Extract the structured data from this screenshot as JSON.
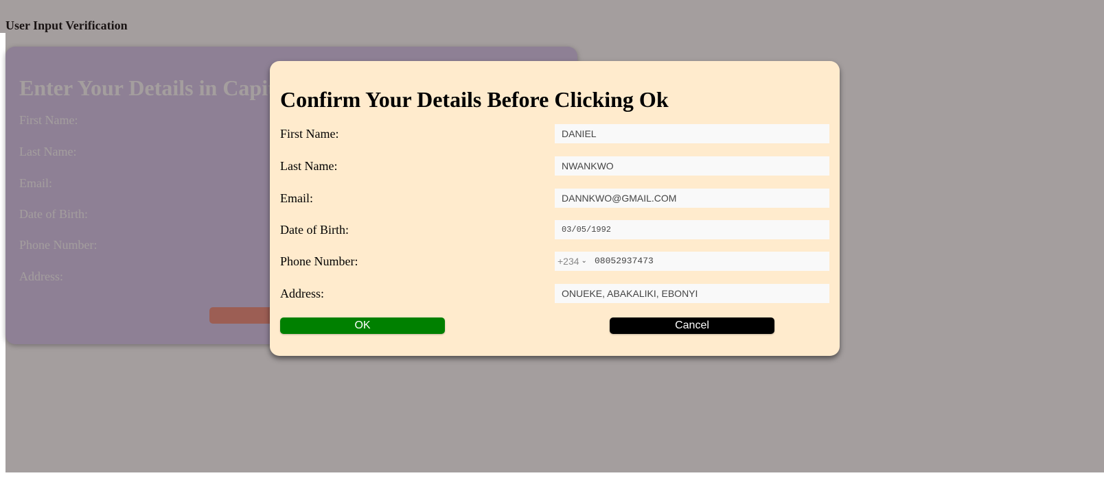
{
  "page": {
    "heading": "User Input Verification"
  },
  "form": {
    "title": "Enter Your Details in Capital Letters",
    "labels": [
      "First Name:",
      "Last Name:",
      "Email:",
      "Date of Birth:",
      "Phone Number:",
      "Address:"
    ]
  },
  "modal": {
    "title": "Confirm Your Details Before Clicking Ok",
    "fields": [
      {
        "label": "First Name:",
        "value": "DANIEL"
      },
      {
        "label": "Last Name:",
        "value": "NWANKWO"
      },
      {
        "label": "Email:",
        "value": "DANNKWO@GMAIL.COM"
      },
      {
        "label": "Date of Birth:",
        "value": "03/05/1992"
      },
      {
        "label": "Phone Number:",
        "value": "08052937473",
        "country_code": "+234"
      },
      {
        "label": "Address:",
        "value": "ONUEKE, ABAKALIKI, EBONYI"
      }
    ],
    "ok_label": "OK",
    "cancel_label": "Cancel"
  },
  "colors": {
    "modal_bg": "#ffebcd",
    "ok_button": "#008000",
    "cancel_button": "#000000",
    "form_card_bg": "#d6c8ef",
    "overlay": "rgba(57,44,44,0.46)"
  },
  "icons": {
    "select_chevron": "chevron-down-icon"
  }
}
